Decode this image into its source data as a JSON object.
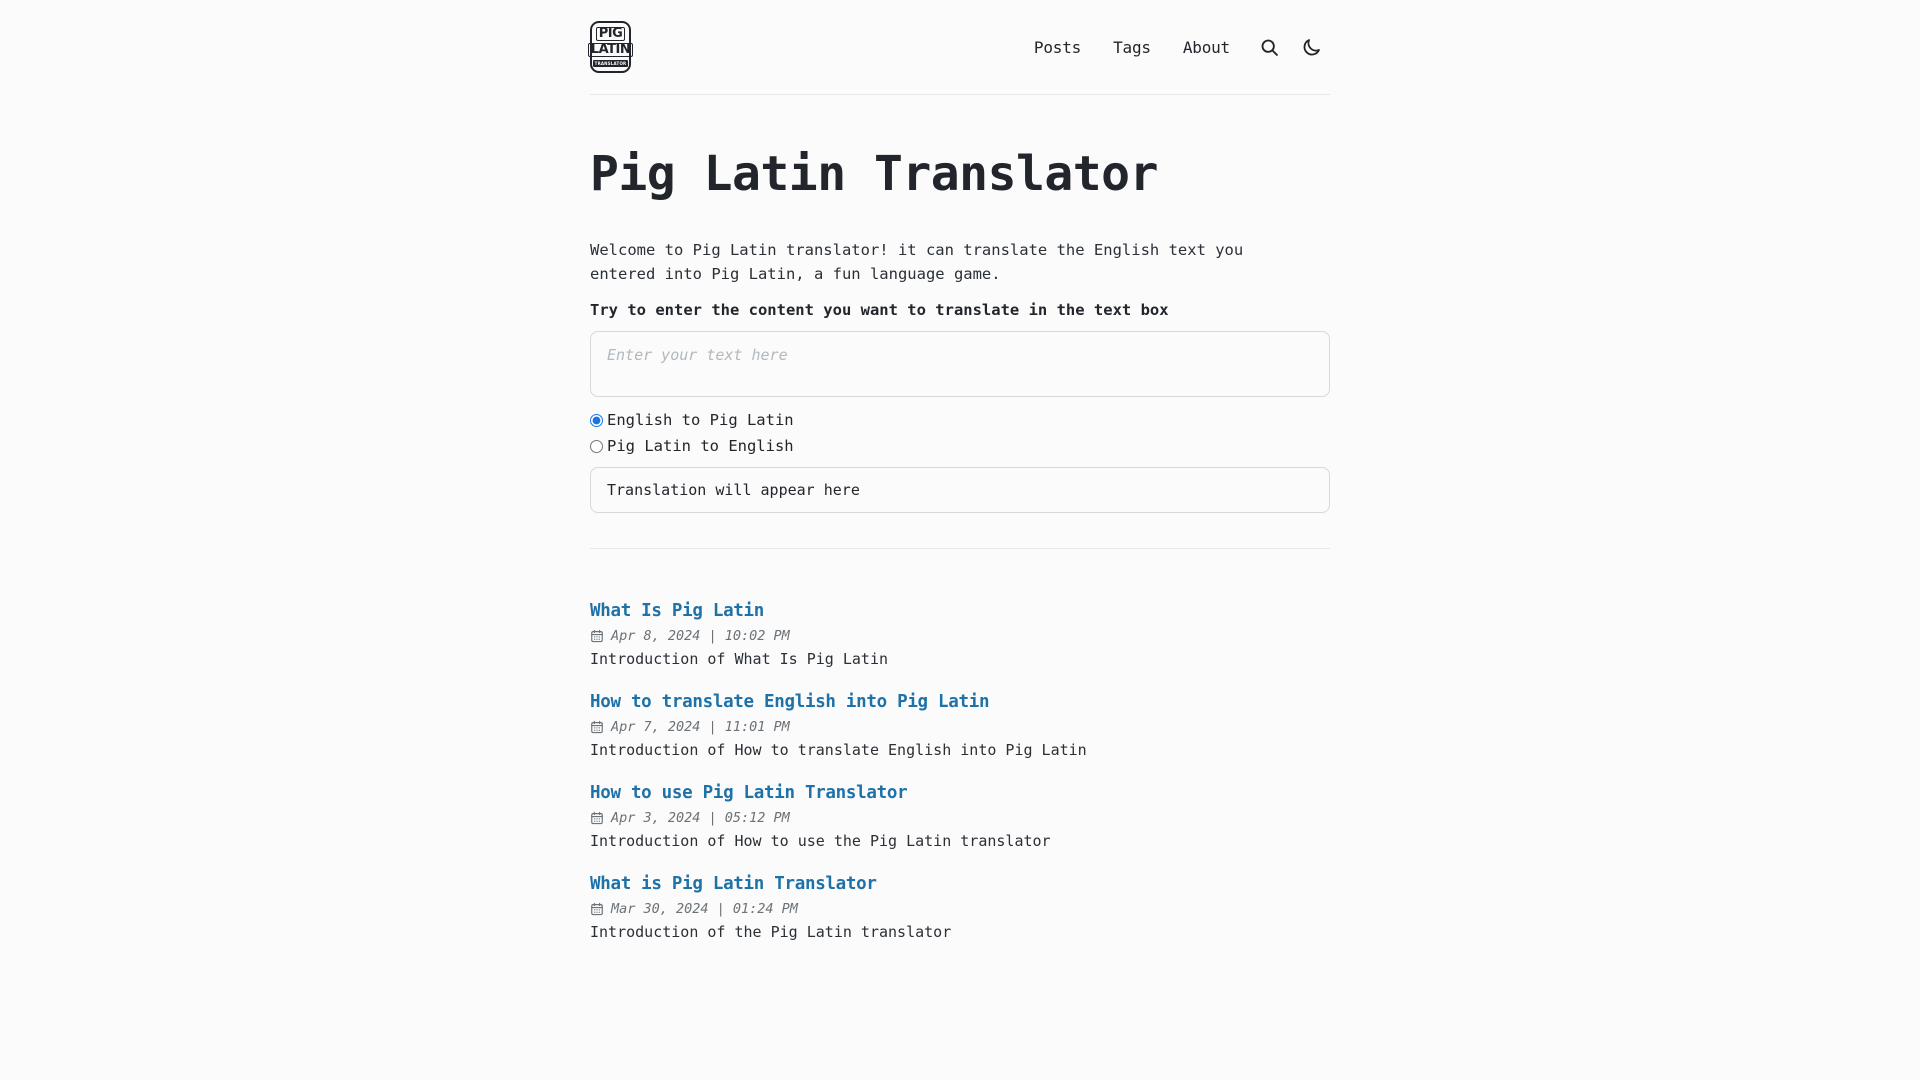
{
  "site": {
    "background_color": "#fafbfa",
    "text_color": "#22252b",
    "link_color": "#1f72a8",
    "accent_color": "#1a73e8",
    "border_color": "#d6dad6"
  },
  "header": {
    "logo": {
      "line1": "PIG",
      "line2": "LATIN",
      "line3": "TRANSLATOR",
      "icon": "pig-latin-translator-logo"
    },
    "nav": [
      {
        "label": "Posts"
      },
      {
        "label": "Tags"
      },
      {
        "label": "About"
      }
    ],
    "search_icon": "search-icon",
    "theme_toggle_icon": "moon-icon"
  },
  "main": {
    "title": "Pig Latin Translator",
    "intro": "Welcome to Pig Latin translator! it can translate the English text you entered into Pig Latin, a fun language game.",
    "instruction": "Try to enter the content you want to translate in the text box",
    "input_placeholder": "Enter your text here",
    "input_value": "",
    "options": [
      {
        "label": "English to Pig Latin",
        "checked": true
      },
      {
        "label": "Pig Latin to English",
        "checked": false
      }
    ],
    "output_text": "Translation will appear here"
  },
  "posts": [
    {
      "title": "What Is Pig Latin",
      "date": "Apr 8, 2024 | 10:02 PM",
      "description": "Introduction of What Is Pig Latin"
    },
    {
      "title": "How to translate English into Pig Latin",
      "date": "Apr 7, 2024 | 11:01 PM",
      "description": "Introduction of How to translate English into Pig Latin"
    },
    {
      "title": "How to use Pig Latin Translator",
      "date": "Apr 3, 2024 | 05:12 PM",
      "description": "Introduction of How to use the Pig Latin translator"
    },
    {
      "title": "What is Pig Latin Translator",
      "date": "Mar 30, 2024 | 01:24 PM",
      "description": "Introduction of the Pig Latin translator"
    }
  ]
}
